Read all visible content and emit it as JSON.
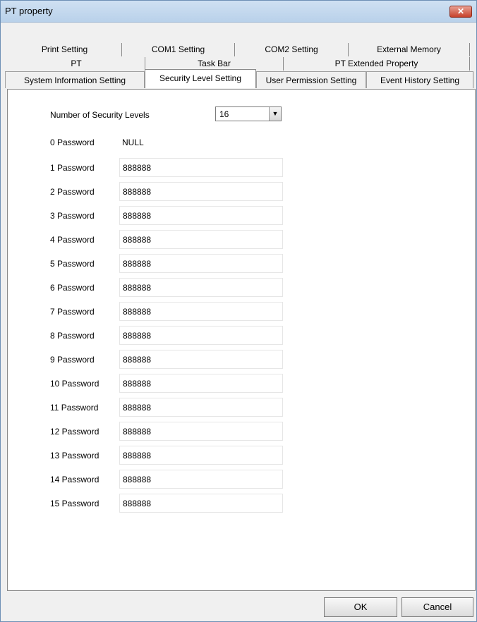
{
  "window": {
    "title": "PT property",
    "close_label": "✕"
  },
  "tabs": {
    "row1": [
      "Print Setting",
      "COM1 Setting",
      "COM2 Setting",
      "External Memory"
    ],
    "row2": [
      "PT",
      "Task Bar",
      "PT Extended Property"
    ],
    "row3": [
      "System Information Setting",
      "Security Level Setting",
      "User Permission Setting",
      "Event History Setting"
    ],
    "active": "Security Level Setting"
  },
  "security": {
    "levels_label": "Number of Security Levels",
    "levels_value": "16",
    "combo_arrow": "▼",
    "password0_label": "0 Password",
    "password0_value": "NULL",
    "passwords": [
      {
        "label": "1 Password",
        "value": "888888"
      },
      {
        "label": "2 Password",
        "value": "888888"
      },
      {
        "label": "3 Password",
        "value": "888888"
      },
      {
        "label": "4 Password",
        "value": "888888"
      },
      {
        "label": "5 Password",
        "value": "888888"
      },
      {
        "label": "6 Password",
        "value": "888888"
      },
      {
        "label": "7 Password",
        "value": "888888"
      },
      {
        "label": "8 Password",
        "value": "888888"
      },
      {
        "label": "9 Password",
        "value": "888888"
      },
      {
        "label": "10 Password",
        "value": "888888"
      },
      {
        "label": "11 Password",
        "value": "888888"
      },
      {
        "label": "12 Password",
        "value": "888888"
      },
      {
        "label": "13 Password",
        "value": "888888"
      },
      {
        "label": "14 Password",
        "value": "888888"
      },
      {
        "label": "15 Password",
        "value": "888888"
      }
    ]
  },
  "buttons": {
    "ok": "OK",
    "cancel": "Cancel"
  }
}
